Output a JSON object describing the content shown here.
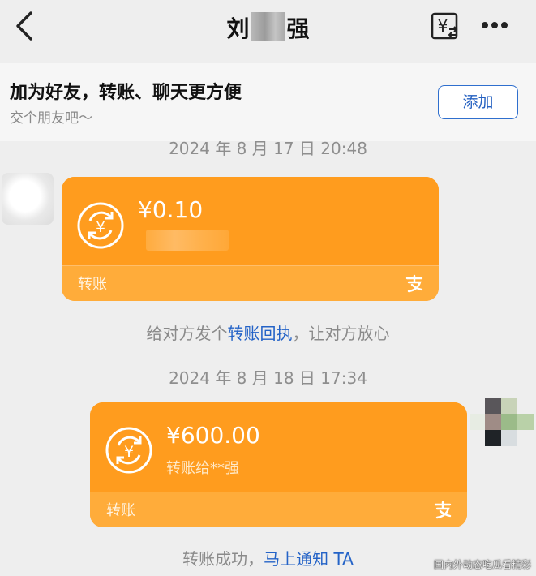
{
  "header": {
    "title_left": "刘",
    "title_right": "强",
    "back_icon": "chevron-left-icon",
    "yuan_icon": "yuan-transfer-icon",
    "more_icon": "more-dots-icon"
  },
  "add_friend_bar": {
    "title": "加为好友，转账、聊天更方便",
    "subtitle": "交个朋友吧～",
    "add_label": "添加"
  },
  "messages": {
    "top_timestamp": "2024 年 8 月 17 日 20:48",
    "received": {
      "amount": "¥0.10",
      "footer_label": "转账",
      "coin_icon": "transfer-coin-icon",
      "brand_icon": "alipay-icon"
    },
    "receipt_notice": {
      "prefix": "给对方发个",
      "link": "转账回执",
      "suffix": "，让对方放心"
    },
    "second_timestamp": "2024 年 8 月 18 日 17:34",
    "sent": {
      "amount": "¥600.00",
      "subtitle": "转账给**强",
      "footer_label": "转账",
      "coin_icon": "transfer-coin-icon",
      "brand_icon": "alipay-icon"
    },
    "success_notice": {
      "prefix": "转账成功，",
      "link": "马上通知 TA"
    }
  },
  "watermark": "国内外动态吃瓜看精彩",
  "colors": {
    "card_orange": "#ff9c1e",
    "link_blue": "#2463c7",
    "background": "#eeeeee"
  }
}
